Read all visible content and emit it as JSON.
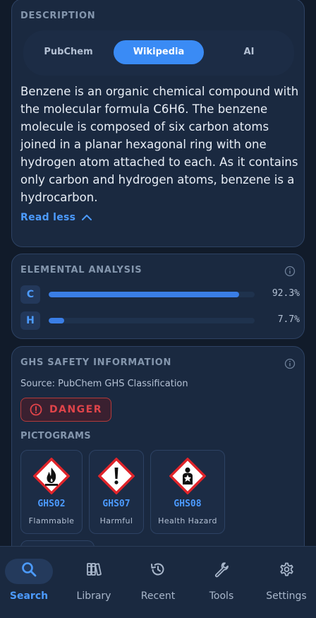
{
  "description": {
    "title": "DESCRIPTION",
    "tabs": [
      {
        "label": "PubChem",
        "active": false
      },
      {
        "label": "Wikipedia",
        "active": true
      },
      {
        "label": "AI",
        "active": false
      }
    ],
    "text": "Benzene is an organic chemical compound with the molecular formula C6H6. The benzene molecule is composed of six carbon atoms joined in a planar hexagonal ring with one hydrogen atom attached to each. As it contains only carbon and hydrogen atoms, benzene is a hydrocarbon.",
    "read_less": "Read less"
  },
  "elemental": {
    "title": "ELEMENTAL ANALYSIS",
    "rows": [
      {
        "symbol": "C",
        "percent_label": "92.3%",
        "fraction": 0.923
      },
      {
        "symbol": "H",
        "percent_label": "7.7%",
        "fraction": 0.077
      }
    ]
  },
  "ghs": {
    "title": "GHS SAFETY INFORMATION",
    "source": "Source: PubChem GHS Classification",
    "signal_word": "DANGER",
    "pictograms_label": "PICTOGRAMS",
    "pictograms": [
      {
        "code": "GHS02",
        "name": "Flammable",
        "icon": "flame-icon"
      },
      {
        "code": "GHS07",
        "name": "Harmful",
        "icon": "exclamation-icon"
      },
      {
        "code": "GHS08",
        "name": "Health Hazard",
        "icon": "health-hazard-icon"
      }
    ]
  },
  "nav": {
    "items": [
      {
        "label": "Search",
        "icon": "search-icon",
        "active": true
      },
      {
        "label": "Library",
        "icon": "library-icon",
        "active": false
      },
      {
        "label": "Recent",
        "icon": "history-icon",
        "active": false
      },
      {
        "label": "Tools",
        "icon": "wrench-icon",
        "active": false
      },
      {
        "label": "Settings",
        "icon": "gear-icon",
        "active": false
      }
    ]
  },
  "colors": {
    "accent": "#3a8bf5",
    "danger": "#e0444a",
    "card": "#1a2940"
  }
}
